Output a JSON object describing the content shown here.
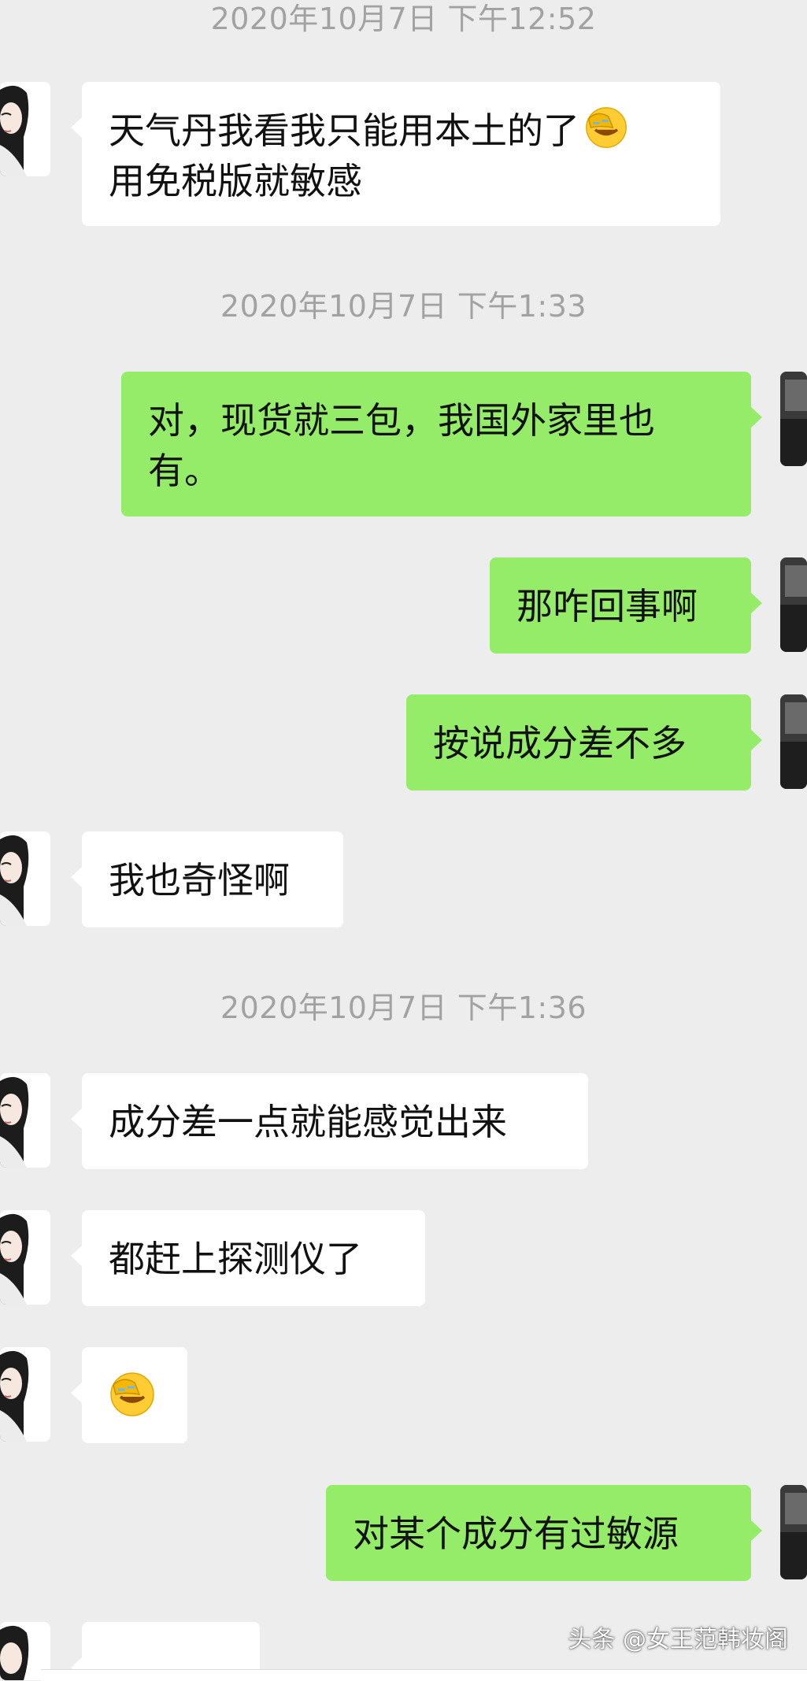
{
  "messages": [
    {
      "type": "timestamp",
      "text": "2020年10月7日 下午12:52"
    },
    {
      "type": "received",
      "text": "天气丹我看我只能用本土的了",
      "emoji": "facepalm-emoji",
      "text2": "用免税版就敏感"
    },
    {
      "type": "timestamp",
      "text": "2020年10月7日 下午1:33"
    },
    {
      "type": "sent",
      "text": "对，现货就三包，我国外家里也",
      "text2": "有。"
    },
    {
      "type": "sent",
      "text": "那咋回事啊"
    },
    {
      "type": "sent",
      "text": "按说成分差不多"
    },
    {
      "type": "received",
      "text": "我也奇怪啊"
    },
    {
      "type": "timestamp",
      "text": "2020年10月7日 下午1:36"
    },
    {
      "type": "received",
      "text": "成分差一点就能感觉出来"
    },
    {
      "type": "received",
      "text": "都赶上探测仪了"
    },
    {
      "type": "received",
      "emoji": "facepalm-emoji"
    },
    {
      "type": "sent",
      "text": "对某个成分有过敏源"
    }
  ],
  "watermark": "头条 @女王范韩妆阁",
  "colors": {
    "background": "#ededed",
    "sent_bubble": "#95ec69",
    "received_bubble": "#ffffff",
    "timestamp_text": "#a2a2a2"
  }
}
